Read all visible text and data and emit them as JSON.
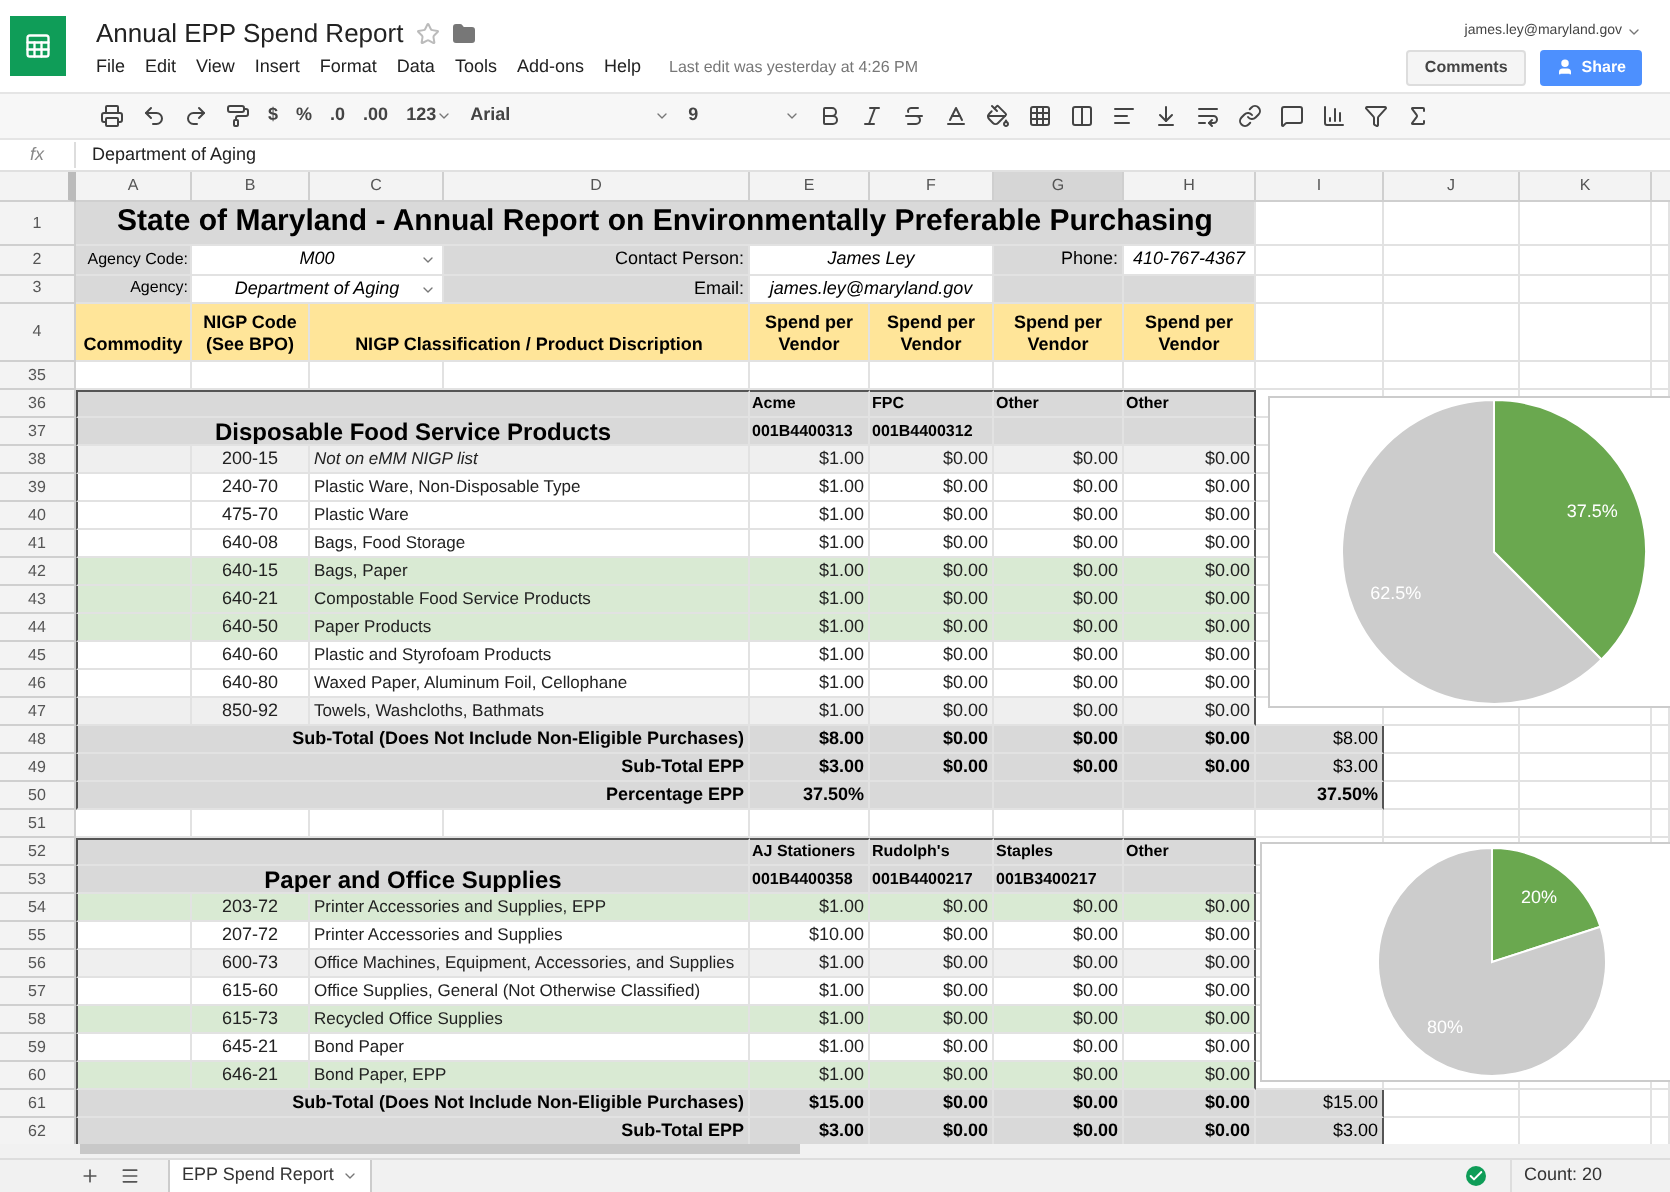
{
  "app": {
    "title": "Annual EPP Spend Report",
    "menus": [
      "File",
      "Edit",
      "View",
      "Insert",
      "Format",
      "Data",
      "Tools",
      "Add-ons",
      "Help"
    ],
    "last_edit": "Last edit was yesterday at 4:26 PM",
    "user": "james.ley@maryland.gov",
    "comments_button": "Comments",
    "share_button": "Share"
  },
  "toolbar": {
    "currency": "$",
    "percent": "%",
    "decrease_decimals": ".0",
    "increase_decimals": ".00",
    "number_format": "123",
    "font": "Arial",
    "font_size": "9"
  },
  "formula_bar": {
    "label": "fx",
    "value": "Department of Aging"
  },
  "columns": [
    {
      "label": "A",
      "selected": false
    },
    {
      "label": "B",
      "selected": false
    },
    {
      "label": "C",
      "selected": false
    },
    {
      "label": "D",
      "selected": false
    },
    {
      "label": "E",
      "selected": false
    },
    {
      "label": "F",
      "selected": false
    },
    {
      "label": "G",
      "selected": true
    },
    {
      "label": "H",
      "selected": false
    },
    {
      "label": "I",
      "selected": false
    },
    {
      "label": "J",
      "selected": false
    },
    {
      "label": "K",
      "selected": false
    }
  ],
  "rows": [
    {
      "n": "1",
      "kind": "title",
      "text": "State of Maryland - Annual Report on Environmentally Preferable Purchasing"
    },
    {
      "n": "2",
      "kind": "info",
      "label": "Agency Code:",
      "value": "M00",
      "contact_label": "Contact Person:",
      "contact": "James Ley",
      "phone_label": "Phone:",
      "phone": "410-767-4367"
    },
    {
      "n": "3",
      "kind": "info",
      "label": "Agency:",
      "value": "Department of Aging",
      "contact_label": "Email:",
      "contact": "james.ley@maryland.gov"
    },
    {
      "n": "4",
      "kind": "header",
      "commodity": "Commodity",
      "code": "NIGP Code (See BPO)",
      "description": "NIGP Classification / Product Discription",
      "spend": [
        "Spend per Vendor",
        "Spend per Vendor",
        "Spend per Vendor",
        "Spend per Vendor"
      ]
    },
    {
      "n": "35",
      "kind": "blank"
    },
    {
      "n": "36",
      "kind": "vendors",
      "vendors": [
        "Acme",
        "FPC",
        "Other",
        "Other"
      ]
    },
    {
      "n": "37",
      "kind": "section_title",
      "title": "Disposable Food Service Products",
      "ids": [
        "001B4400313",
        "001B4400312"
      ]
    },
    {
      "n": "38",
      "kind": "item",
      "code": "200-15",
      "description": "Not on eMM NIGP list",
      "italic": true,
      "epp": false,
      "banded": true,
      "values": [
        "$1.00",
        "$0.00",
        "$0.00",
        "$0.00"
      ]
    },
    {
      "n": "39",
      "kind": "item",
      "code": "240-70",
      "description": "Plastic Ware, Non-Disposable Type",
      "italic": false,
      "epp": false,
      "banded": false,
      "values": [
        "$1.00",
        "$0.00",
        "$0.00",
        "$0.00"
      ]
    },
    {
      "n": "40",
      "kind": "item",
      "code": "475-70",
      "description": "Plastic Ware",
      "italic": false,
      "epp": false,
      "banded": false,
      "values": [
        "$1.00",
        "$0.00",
        "$0.00",
        "$0.00"
      ]
    },
    {
      "n": "41",
      "kind": "item",
      "code": "640-08",
      "description": "Bags, Food Storage",
      "italic": false,
      "epp": false,
      "banded": false,
      "values": [
        "$1.00",
        "$0.00",
        "$0.00",
        "$0.00"
      ]
    },
    {
      "n": "42",
      "kind": "item",
      "code": "640-15",
      "description": "Bags, Paper",
      "italic": false,
      "epp": true,
      "banded": false,
      "values": [
        "$1.00",
        "$0.00",
        "$0.00",
        "$0.00"
      ]
    },
    {
      "n": "43",
      "kind": "item",
      "code": "640-21",
      "description": "Compostable Food Service Products",
      "italic": false,
      "epp": true,
      "banded": false,
      "values": [
        "$1.00",
        "$0.00",
        "$0.00",
        "$0.00"
      ]
    },
    {
      "n": "44",
      "kind": "item",
      "code": "640-50",
      "description": "Paper Products",
      "italic": false,
      "epp": true,
      "banded": false,
      "values": [
        "$1.00",
        "$0.00",
        "$0.00",
        "$0.00"
      ]
    },
    {
      "n": "45",
      "kind": "item",
      "code": "640-60",
      "description": "Plastic and Styrofoam Products",
      "italic": false,
      "epp": false,
      "banded": false,
      "values": [
        "$1.00",
        "$0.00",
        "$0.00",
        "$0.00"
      ]
    },
    {
      "n": "46",
      "kind": "item",
      "code": "640-80",
      "description": "Waxed Paper, Aluminum Foil, Cellophane",
      "italic": false,
      "epp": false,
      "banded": false,
      "values": [
        "$1.00",
        "$0.00",
        "$0.00",
        "$0.00"
      ]
    },
    {
      "n": "47",
      "kind": "item",
      "code": "850-92",
      "description": "Towels, Washcloths, Bathmats",
      "italic": false,
      "epp": false,
      "banded": true,
      "values": [
        "$1.00",
        "$0.00",
        "$0.00",
        "$0.00"
      ]
    },
    {
      "n": "48",
      "kind": "subtotal",
      "label": "Sub-Total (Does Not Include Non-Eligible Purchases)",
      "values": [
        "$8.00",
        "$0.00",
        "$0.00",
        "$0.00"
      ],
      "total": "$8.00",
      "total_bold": false
    },
    {
      "n": "49",
      "kind": "subtotal",
      "label": "Sub-Total EPP",
      "values": [
        "$3.00",
        "$0.00",
        "$0.00",
        "$0.00"
      ],
      "total": "$3.00",
      "total_bold": false
    },
    {
      "n": "50",
      "kind": "subtotal",
      "label": "Percentage EPP",
      "values": [
        "37.50%"
      ],
      "total": "37.50%",
      "total_bold": true
    },
    {
      "n": "51",
      "kind": "blank"
    },
    {
      "n": "52",
      "kind": "vendors",
      "vendors": [
        "AJ Stationers",
        "Rudolph's",
        "Staples",
        "Other"
      ]
    },
    {
      "n": "53",
      "kind": "section_title",
      "title": "Paper and Office Supplies",
      "ids": [
        "001B4400358",
        "001B4400217",
        "001B3400217"
      ]
    },
    {
      "n": "54",
      "kind": "item",
      "code": "203-72",
      "description": "Printer Accessories and Supplies, EPP",
      "italic": false,
      "epp": true,
      "banded": false,
      "values": [
        "$1.00",
        "$0.00",
        "$0.00",
        "$0.00"
      ]
    },
    {
      "n": "55",
      "kind": "item",
      "code": "207-72",
      "description": "Printer Accessories and Supplies",
      "italic": false,
      "epp": false,
      "banded": false,
      "values": [
        "$10.00",
        "$0.00",
        "$0.00",
        "$0.00"
      ]
    },
    {
      "n": "56",
      "kind": "item",
      "code": "600-73",
      "description": "Office Machines, Equipment, Accessories, and Supplies",
      "italic": false,
      "epp": false,
      "banded": true,
      "values": [
        "$1.00",
        "$0.00",
        "$0.00",
        "$0.00"
      ]
    },
    {
      "n": "57",
      "kind": "item",
      "code": "615-60",
      "description": "Office Supplies, General (Not Otherwise Classified)",
      "italic": false,
      "epp": false,
      "banded": false,
      "values": [
        "$1.00",
        "$0.00",
        "$0.00",
        "$0.00"
      ]
    },
    {
      "n": "58",
      "kind": "item",
      "code": "615-73",
      "description": "Recycled Office Supplies",
      "italic": false,
      "epp": true,
      "banded": false,
      "values": [
        "$1.00",
        "$0.00",
        "$0.00",
        "$0.00"
      ]
    },
    {
      "n": "59",
      "kind": "item",
      "code": "645-21",
      "description": "Bond Paper",
      "italic": false,
      "epp": false,
      "banded": false,
      "values": [
        "$1.00",
        "$0.00",
        "$0.00",
        "$0.00"
      ]
    },
    {
      "n": "60",
      "kind": "item",
      "code": "646-21",
      "description": "Bond Paper, EPP",
      "italic": false,
      "epp": true,
      "banded": false,
      "values": [
        "$1.00",
        "$0.00",
        "$0.00",
        "$0.00"
      ]
    },
    {
      "n": "61",
      "kind": "subtotal",
      "label": "Sub-Total (Does Not Include Non-Eligible Purchases)",
      "values": [
        "$15.00",
        "$0.00",
        "$0.00",
        "$0.00"
      ],
      "total": "$15.00",
      "total_bold": false
    },
    {
      "n": "62",
      "kind": "subtotal",
      "label": "Sub-Total EPP",
      "values": [
        "$3.00",
        "$0.00",
        "$0.00",
        "$0.00"
      ],
      "total": "$3.00",
      "total_bold": false
    }
  ],
  "charts": [
    {
      "chart_data": {
        "type": "pie",
        "values": [
          37.5,
          62.5
        ],
        "value_labels": [
          "37.5%",
          "62.5%"
        ]
      }
    },
    {
      "chart_data": {
        "type": "pie",
        "values": [
          20,
          80
        ],
        "value_labels": [
          "20%",
          "80%"
        ]
      }
    }
  ],
  "sheet_tabs": [
    {
      "label": "EPP Spend Report",
      "selected": true
    }
  ],
  "status": {
    "count": "Count: 20"
  }
}
